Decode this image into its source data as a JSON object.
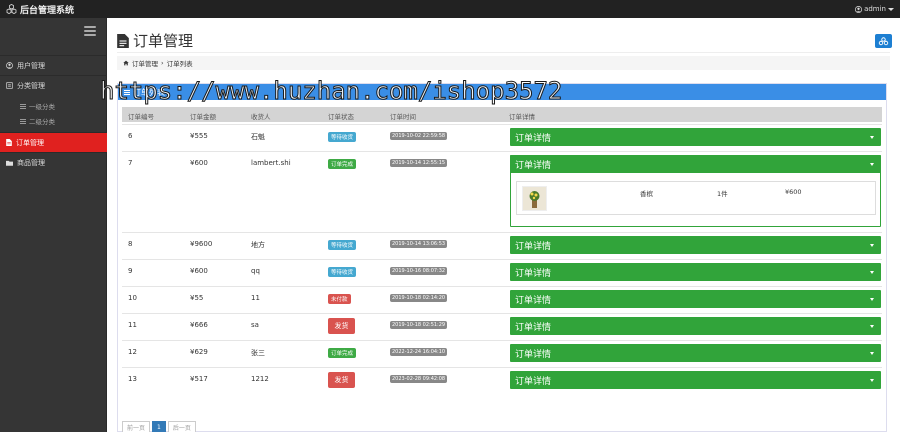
{
  "app": {
    "brand": "后台管理系统",
    "user": "admin"
  },
  "sidebar": {
    "items": [
      {
        "label": "用户管理",
        "icon": "user-icon"
      },
      {
        "label": "分类管理",
        "icon": "category-icon"
      },
      {
        "label": "订单管理",
        "icon": "file-icon"
      },
      {
        "label": "商品管理",
        "icon": "folder-icon"
      }
    ],
    "sub_items": [
      "一级分类",
      "二级分类"
    ],
    "active": "订单管理"
  },
  "page": {
    "title": "订单管理"
  },
  "breadcrumb": {
    "root": "订单管理",
    "sep": "›",
    "current": "订单列表"
  },
  "panel": {
    "title": "订单列表"
  },
  "table": {
    "headers": [
      "订单编号",
      "订单金额",
      "收货人",
      "订单状态",
      "订单时间",
      "订单详情"
    ],
    "rows": [
      {
        "id": "6",
        "amount": "¥555",
        "receiver": "石魁",
        "status": "等待收货",
        "status_type": "info",
        "time": "2019-10-02 22:59:58",
        "detail": "订单详情"
      },
      {
        "id": "7",
        "amount": "¥600",
        "receiver": "lambert.shi",
        "status": "订单完成",
        "status_type": "success",
        "time": "2019-10-14 12:55:15",
        "detail": "订单详情"
      },
      {
        "id": "8",
        "amount": "¥9600",
        "receiver": "地方",
        "status": "等待收货",
        "status_type": "info",
        "time": "2019-10-14 13:06:53",
        "detail": "订单详情"
      },
      {
        "id": "9",
        "amount": "¥600",
        "receiver": "qq",
        "status": "等待收货",
        "status_type": "info",
        "time": "2019-10-16 08:07:32",
        "detail": "订单详情"
      },
      {
        "id": "10",
        "amount": "¥55",
        "receiver": "11",
        "status": "未付款",
        "status_type": "danger",
        "time": "2019-10-18 02:14:20",
        "detail": "订单详情"
      },
      {
        "id": "11",
        "amount": "¥666",
        "receiver": "sa",
        "status": "发货",
        "status_type": "button",
        "time": "2019-10-18 02:51:29",
        "detail": "订单详情"
      },
      {
        "id": "12",
        "amount": "¥629",
        "receiver": "张三",
        "status": "订单完成",
        "status_type": "success",
        "time": "2022-12-24 16:04:10",
        "detail": "订单详情"
      },
      {
        "id": "13",
        "amount": "¥517",
        "receiver": "1212",
        "status": "发货",
        "status_type": "button",
        "time": "2023-02-28 09:42:08",
        "detail": "订单详情"
      }
    ],
    "expanded_detail": {
      "product_name": "香槟",
      "quantity": "1件",
      "price": "¥600"
    }
  },
  "pager": {
    "prev": "前一页",
    "page": "1",
    "next": "后一页"
  },
  "watermark": "https://www.huzhan.com/ishop3572",
  "colors": {
    "accent": "#e0211f",
    "primary": "#3a8ee6",
    "success": "#31a43a",
    "topbar": "#222222",
    "sidebar": "#353535"
  }
}
